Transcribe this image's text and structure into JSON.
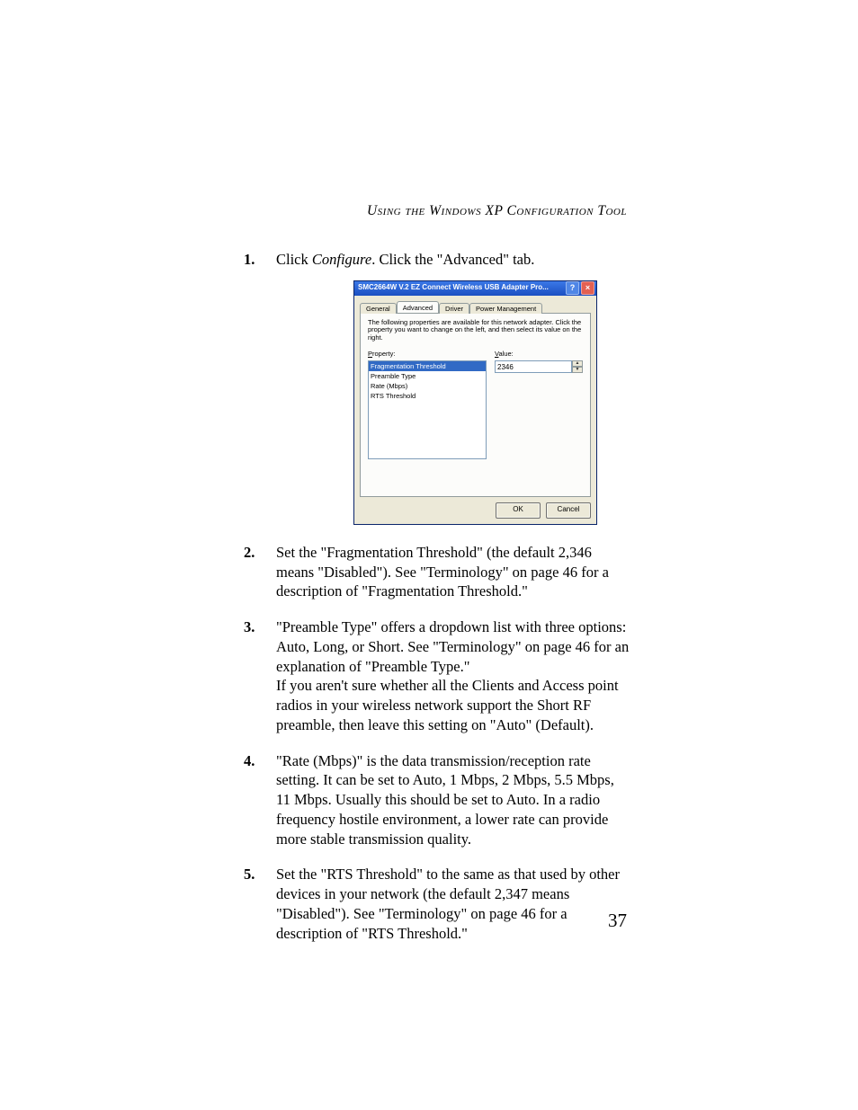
{
  "header": {
    "running_head": "Using the Windows XP Configuration Tool"
  },
  "steps": [
    {
      "num": "1.",
      "prefix": "Click ",
      "em": "Configure",
      "suffix": ". Click the \"Advanced\" tab."
    },
    {
      "num": "2.",
      "text": "Set the \"Fragmentation Threshold\" (the default 2,346 means \"Disabled\"). See \"Terminology\" on page 46 for a description of \"Fragmentation Threshold.\""
    },
    {
      "num": "3.",
      "text": "\"Preamble Type\" offers a dropdown list with three options: Auto, Long, or Short. See \"Terminology\" on page 46 for an explanation of \"Preamble Type.\"\nIf you aren't sure whether all the Clients and Access point radios in your wireless network support the Short RF preamble, then leave this setting on \"Auto\" (Default)."
    },
    {
      "num": "4.",
      "text": "\"Rate (Mbps)\" is the data transmission/reception rate setting. It can be set to Auto, 1 Mbps, 2 Mbps, 5.5 Mbps, 11 Mbps. Usually this should be set to Auto.  In a radio frequency hostile environment, a lower rate can provide more stable transmission quality."
    },
    {
      "num": "5.",
      "text": "Set the \"RTS Threshold\" to the same as that used by other devices in your network (the default 2,347 means \"Disabled\"). See \"Terminology\" on page 46 for a description of \"RTS Threshold.\""
    }
  ],
  "dialog": {
    "title": "SMC2664W V.2 EZ Connect Wireless USB Adapter Pro...",
    "tabs": {
      "general": "General",
      "advanced": "Advanced",
      "driver": "Driver",
      "power": "Power Management"
    },
    "description": "The following properties are available for this network adapter. Click the property you want to change on the left, and then select its value on the right.",
    "property_label_u": "P",
    "property_label_rest": "roperty:",
    "value_label_u": "V",
    "value_label_rest": "alue:",
    "properties": [
      "Fragmentation Threshold",
      "Preamble Type",
      "Rate (Mbps)",
      "RTS Threshold"
    ],
    "value": "2346",
    "ok": "OK",
    "cancel": "Cancel"
  },
  "page_number": "37"
}
